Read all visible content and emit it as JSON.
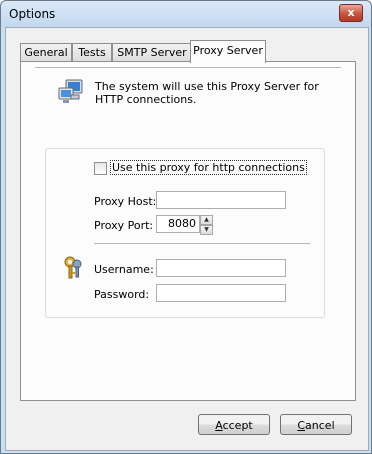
{
  "window": {
    "title": "Options",
    "close_label": "x"
  },
  "tabs": [
    {
      "label": "General"
    },
    {
      "label": "Tests"
    },
    {
      "label": "SMTP Server"
    },
    {
      "label": "Proxy Server",
      "active": true
    }
  ],
  "proxy": {
    "intro": "The system will use this Proxy Server for HTTP connections.",
    "use_proxy_label": "Use this proxy for http connections",
    "use_proxy_checked": false,
    "host_label": "Proxy Host:",
    "host_value": "",
    "port_label": "Proxy Port:",
    "port_value": "8080",
    "username_label": "Username:",
    "username_value": "",
    "password_label": "Password:",
    "password_value": ""
  },
  "buttons": {
    "accept": "Accept",
    "cancel": "Cancel"
  },
  "icons": {
    "network": "network-computer-icon",
    "keys": "keys-icon"
  }
}
